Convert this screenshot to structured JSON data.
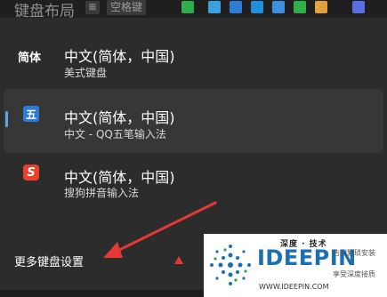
{
  "topbar": {
    "title": "键盘布局",
    "win_key": "⊞",
    "space_key": "空格键",
    "tray_colors": [
      "#2fae4a",
      "#3aa0e0",
      "#2f7bd6",
      "#1e8fd8",
      "#3e8de0",
      "#2fae4a",
      "#e0a23a",
      "#5a6ee0"
    ]
  },
  "inputs": [
    {
      "badge": "简体",
      "name": "中文(简体，中国)",
      "sub": "美式键盘"
    },
    {
      "badge": "五",
      "name": "中文(简体，中国)",
      "sub": "中文 - QQ五笔输入法",
      "selected": true
    },
    {
      "badge": "S",
      "name": "中文(简体，中国)",
      "sub": "搜狗拼音输入法"
    }
  ],
  "footer": {
    "more_settings": "更多键盘设置"
  },
  "colors": {
    "accent": "#60a5e8",
    "arrow": "#e53935",
    "wubi_badge": "#2e7bd6",
    "sogou_badge": "#e8432a"
  },
  "watermark": {
    "brand_cn": "深度 · 技术",
    "brand": "IDEEPIN",
    "url": "WWW.IDEEPIN.COM",
    "right_line1": "告别繁琐安装",
    "right_line2": "享受深度接质"
  }
}
